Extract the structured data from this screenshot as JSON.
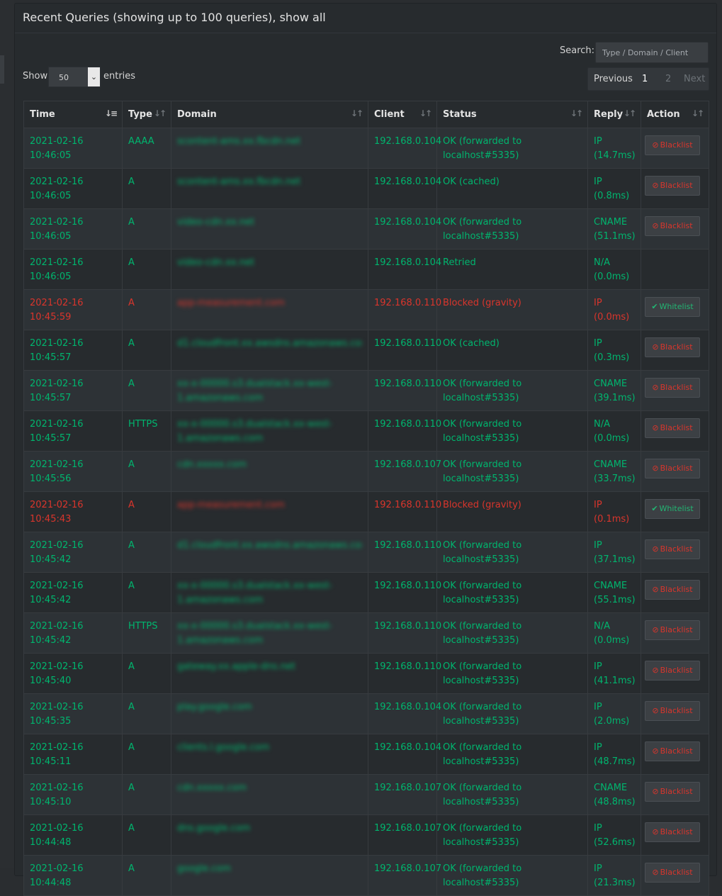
{
  "header": {
    "title": "Recent Queries (showing up to 100 queries), show all"
  },
  "search": {
    "label": "Search:",
    "placeholder": "Type / Domain / Client"
  },
  "length": {
    "show_label": "Show",
    "value": "50",
    "entries_label": "entries"
  },
  "pagination": {
    "previous": "Previous",
    "pages": [
      "1",
      "2"
    ],
    "current": "1",
    "next": "Next"
  },
  "columns": [
    "Time",
    "Type",
    "Domain",
    "Client",
    "Status",
    "Reply",
    "Action"
  ],
  "colors": {
    "ok": "#00b56e",
    "blocked": "#d9352c"
  },
  "rows": [
    {
      "time": "2021-02-16 10:46:05",
      "type": "AAAA",
      "domain": "scontent-ams.xx.fbcdn.net",
      "client": "192.168.0.104",
      "status": "OK (forwarded to localhost#5335)",
      "reply": "IP (14.7ms)",
      "action": "Blacklist",
      "blocked": false
    },
    {
      "time": "2021-02-16 10:46:05",
      "type": "A",
      "domain": "scontent-ams.xx.fbcdn.net",
      "client": "192.168.0.104",
      "status": "OK (cached)",
      "reply": "IP (0.8ms)",
      "action": "Blacklist",
      "blocked": false
    },
    {
      "time": "2021-02-16 10:46:05",
      "type": "A",
      "domain": "video-cdn.xx.net",
      "client": "192.168.0.104",
      "status": "OK (forwarded to localhost#5335)",
      "reply": "CNAME (51.1ms)",
      "action": "Blacklist",
      "blocked": false
    },
    {
      "time": "2021-02-16 10:46:05",
      "type": "A",
      "domain": "video-cdn.xx.net",
      "client": "192.168.0.104",
      "status": "Retried",
      "reply": "N/A (0.0ms)",
      "action": "",
      "blocked": false
    },
    {
      "time": "2021-02-16 10:45:59",
      "type": "A",
      "domain": "app-measurement.com",
      "client": "192.168.0.110",
      "status": "Blocked (gravity)",
      "reply": "IP (0.0ms)",
      "action": "Whitelist",
      "blocked": true
    },
    {
      "time": "2021-02-16 10:45:57",
      "type": "A",
      "domain": "d1.cloudfront.xx.awsdns.amazonaws.com",
      "client": "192.168.0.110",
      "status": "OK (cached)",
      "reply": "IP (0.3ms)",
      "action": "Blacklist",
      "blocked": false
    },
    {
      "time": "2021-02-16 10:45:57",
      "type": "A",
      "domain": "xx-x-00000.s3.dualstack.xx-west-1.amazonaws.com",
      "client": "192.168.0.110",
      "status": "OK (forwarded to localhost#5335)",
      "reply": "CNAME (39.1ms)",
      "action": "Blacklist",
      "blocked": false
    },
    {
      "time": "2021-02-16 10:45:57",
      "type": "HTTPS",
      "domain": "xx-x-00000.s3.dualstack.xx-west-1.amazonaws.com",
      "client": "192.168.0.110",
      "status": "OK (forwarded to localhost#5335)",
      "reply": "N/A (0.0ms)",
      "action": "Blacklist",
      "blocked": false
    },
    {
      "time": "2021-02-16 10:45:56",
      "type": "A",
      "domain": "cdn.xxxxx.com",
      "client": "192.168.0.107",
      "status": "OK (forwarded to localhost#5335)",
      "reply": "CNAME (33.7ms)",
      "action": "Blacklist",
      "blocked": false
    },
    {
      "time": "2021-02-16 10:45:43",
      "type": "A",
      "domain": "app-measurement.com",
      "client": "192.168.0.110",
      "status": "Blocked (gravity)",
      "reply": "IP (0.1ms)",
      "action": "Whitelist",
      "blocked": true
    },
    {
      "time": "2021-02-16 10:45:42",
      "type": "A",
      "domain": "d1.cloudfront.xx.awsdns.amazonaws.com",
      "client": "192.168.0.110",
      "status": "OK (forwarded to localhost#5335)",
      "reply": "IP (37.1ms)",
      "action": "Blacklist",
      "blocked": false
    },
    {
      "time": "2021-02-16 10:45:42",
      "type": "A",
      "domain": "xx-x-00000.s3.dualstack.xx-west-1.amazonaws.com",
      "client": "192.168.0.110",
      "status": "OK (forwarded to localhost#5335)",
      "reply": "CNAME (55.1ms)",
      "action": "Blacklist",
      "blocked": false
    },
    {
      "time": "2021-02-16 10:45:42",
      "type": "HTTPS",
      "domain": "xx-x-00000.s3.dualstack.xx-west-1.amazonaws.com",
      "client": "192.168.0.110",
      "status": "OK (forwarded to localhost#5335)",
      "reply": "N/A (0.0ms)",
      "action": "Blacklist",
      "blocked": false
    },
    {
      "time": "2021-02-16 10:45:40",
      "type": "A",
      "domain": "gateway.xx.apple-dns.net",
      "client": "192.168.0.110",
      "status": "OK (forwarded to localhost#5335)",
      "reply": "IP (41.1ms)",
      "action": "Blacklist",
      "blocked": false
    },
    {
      "time": "2021-02-16 10:45:35",
      "type": "A",
      "domain": "play.google.com",
      "client": "192.168.0.104",
      "status": "OK (forwarded to localhost#5335)",
      "reply": "IP (2.0ms)",
      "action": "Blacklist",
      "blocked": false
    },
    {
      "time": "2021-02-16 10:45:11",
      "type": "A",
      "domain": "clients.l.google.com",
      "client": "192.168.0.104",
      "status": "OK (forwarded to localhost#5335)",
      "reply": "IP (48.7ms)",
      "action": "Blacklist",
      "blocked": false
    },
    {
      "time": "2021-02-16 10:45:10",
      "type": "A",
      "domain": "cdn.xxxxx.com",
      "client": "192.168.0.107",
      "status": "OK (forwarded to localhost#5335)",
      "reply": "CNAME (48.8ms)",
      "action": "Blacklist",
      "blocked": false
    },
    {
      "time": "2021-02-16 10:44:48",
      "type": "A",
      "domain": "dns.google.com",
      "client": "192.168.0.107",
      "status": "OK (forwarded to localhost#5335)",
      "reply": "IP (52.6ms)",
      "action": "Blacklist",
      "blocked": false
    },
    {
      "time": "2021-02-16 10:44:48",
      "type": "A",
      "domain": "google.com",
      "client": "192.168.0.107",
      "status": "OK (forwarded to localhost#5335)",
      "reply": "IP (21.3ms)",
      "action": "Blacklist",
      "blocked": false
    }
  ]
}
